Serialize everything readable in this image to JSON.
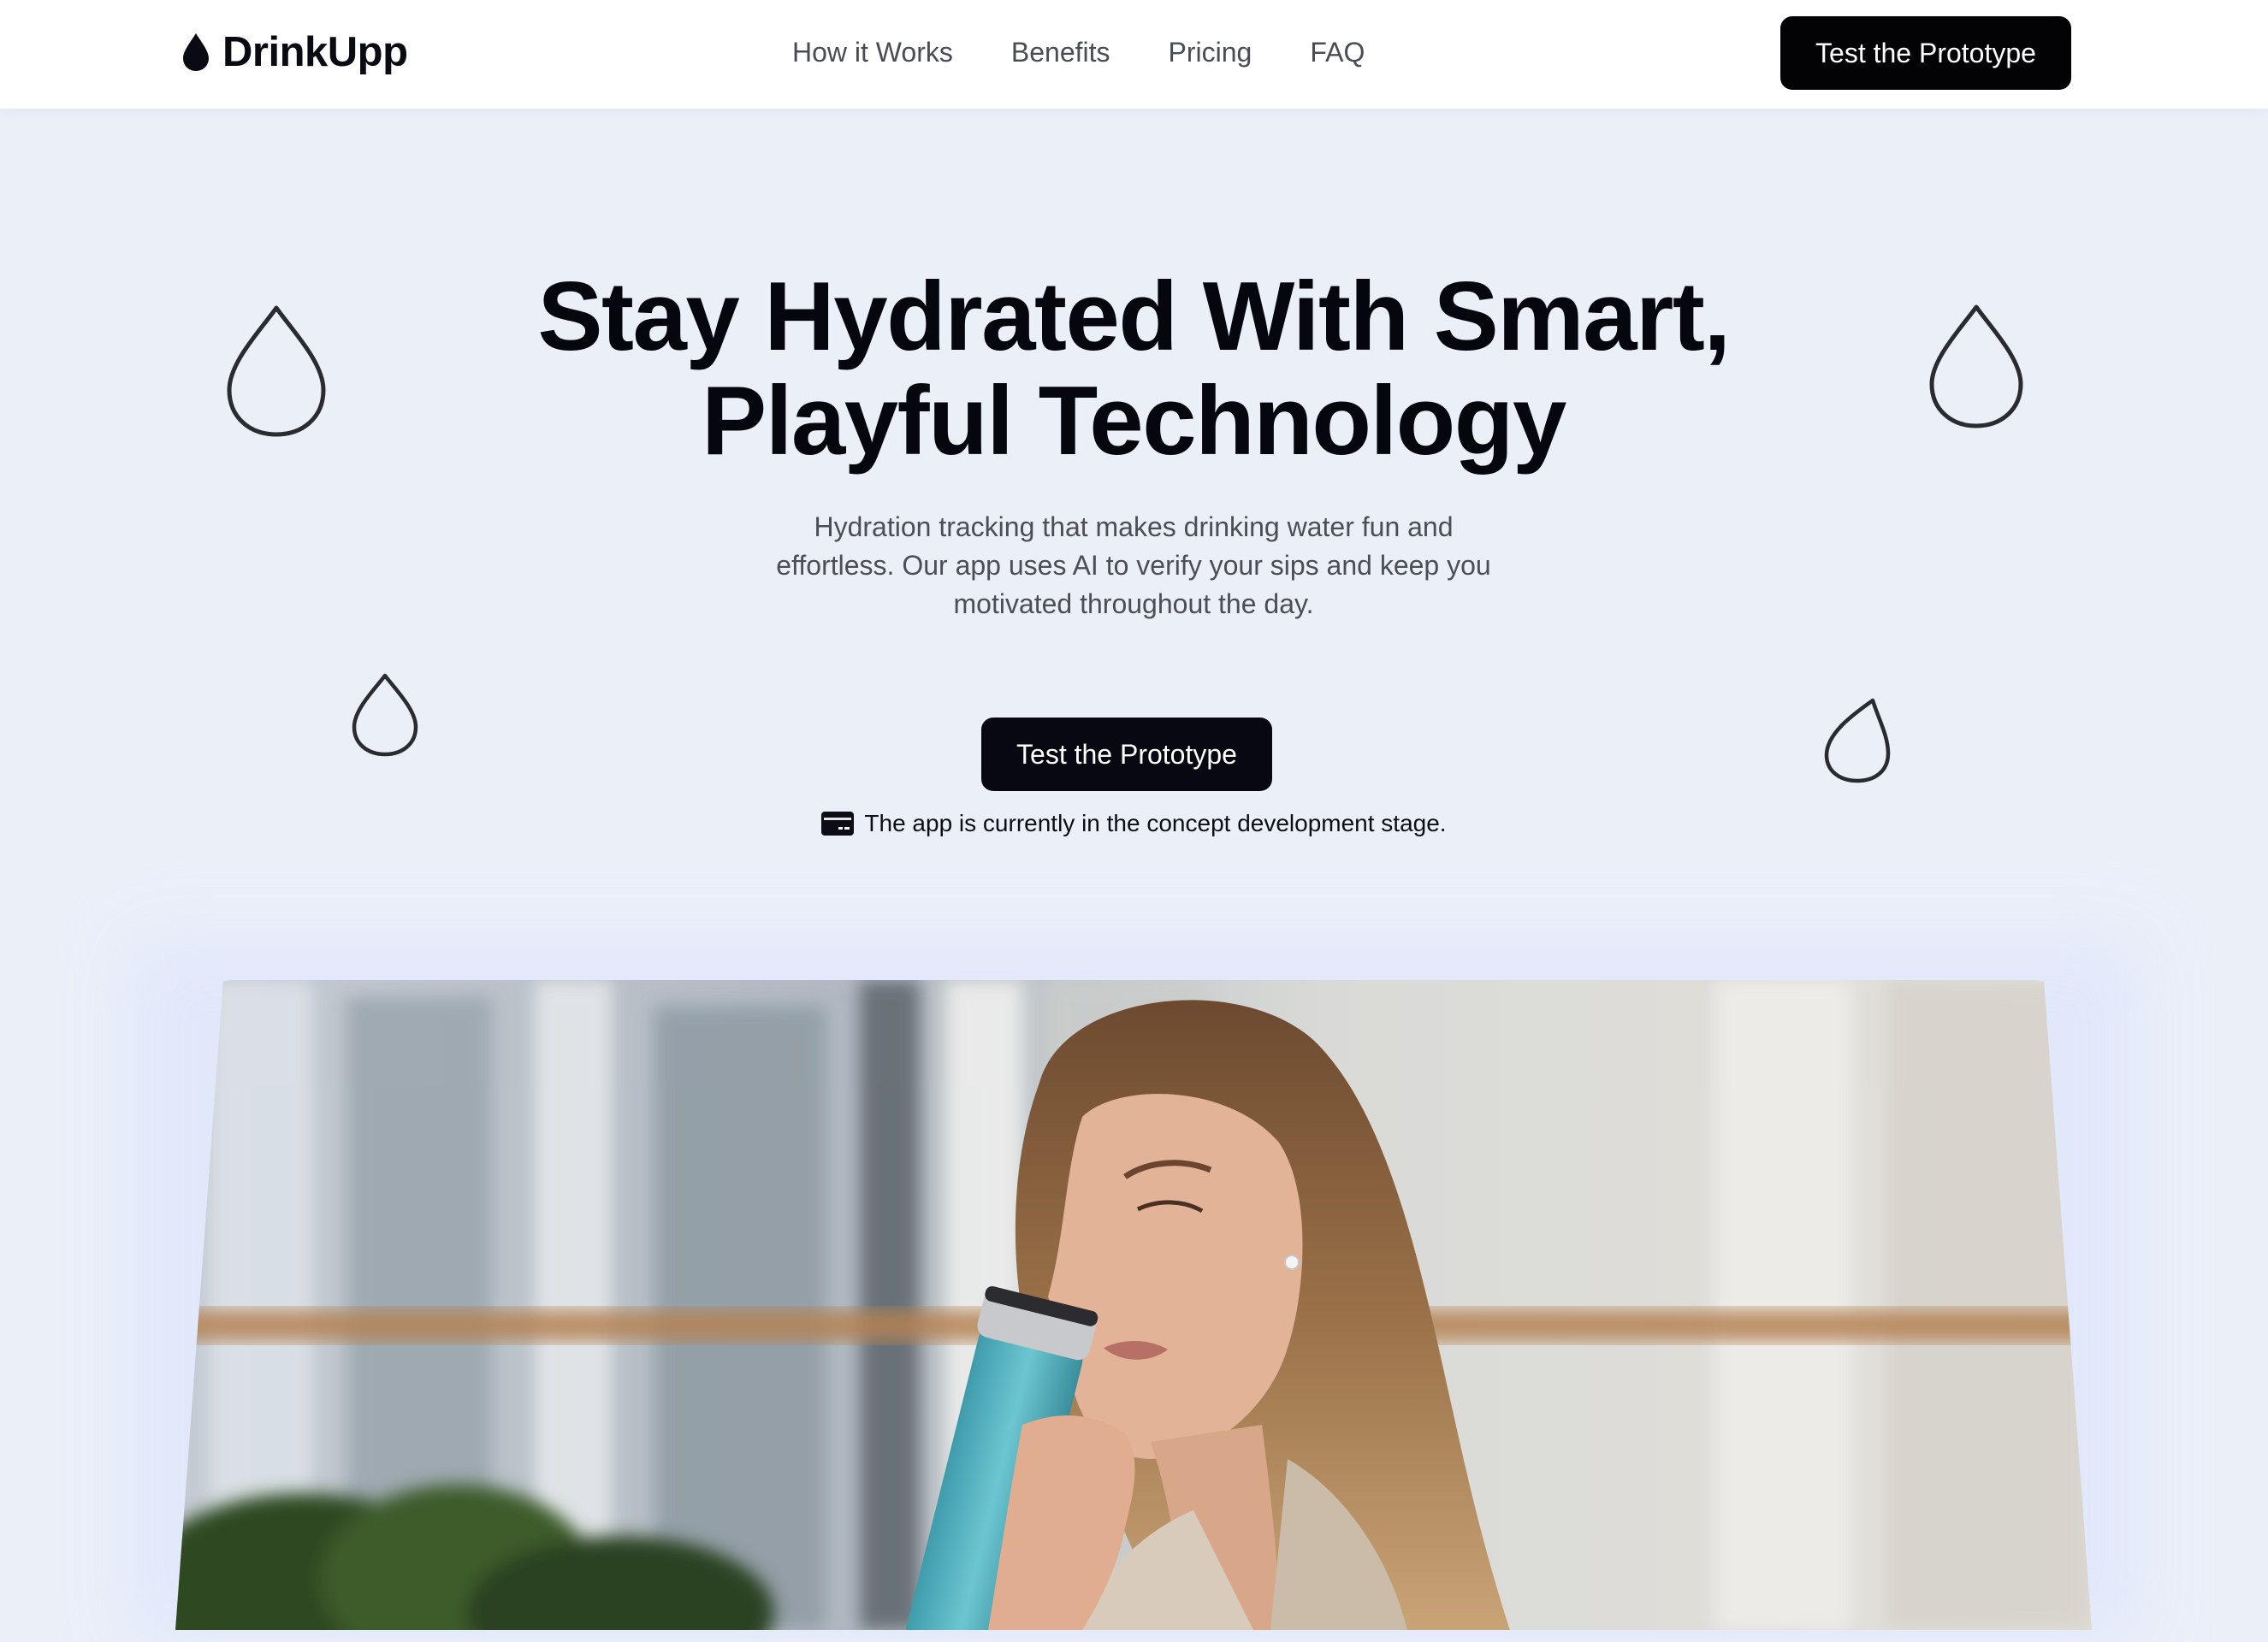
{
  "brand": {
    "name": "DrinkUpp",
    "logo_icon": "water-drop-icon"
  },
  "nav": {
    "items": [
      {
        "label": "How it Works"
      },
      {
        "label": "Benefits"
      },
      {
        "label": "Pricing"
      },
      {
        "label": "FAQ"
      }
    ]
  },
  "header": {
    "cta_label": "Test the Prototype"
  },
  "hero": {
    "title_line1": "Stay Hydrated With Smart,",
    "title_line2": "Playful Technology",
    "subtitle": "Hydration tracking that makes drinking water fun and effortless. Our app uses AI to verify your sips and keep you motivated throughout the day.",
    "cta_label": "Test the Prototype",
    "notice_icon": "card-icon",
    "notice_text": "The app is currently in the concept development stage."
  },
  "colors": {
    "background": "#ebeff8",
    "header_bg": "#ffffff",
    "button_bg": "#030305",
    "button_text": "#ffffff",
    "title": "#06060f",
    "muted_text": "#4b4d57"
  }
}
